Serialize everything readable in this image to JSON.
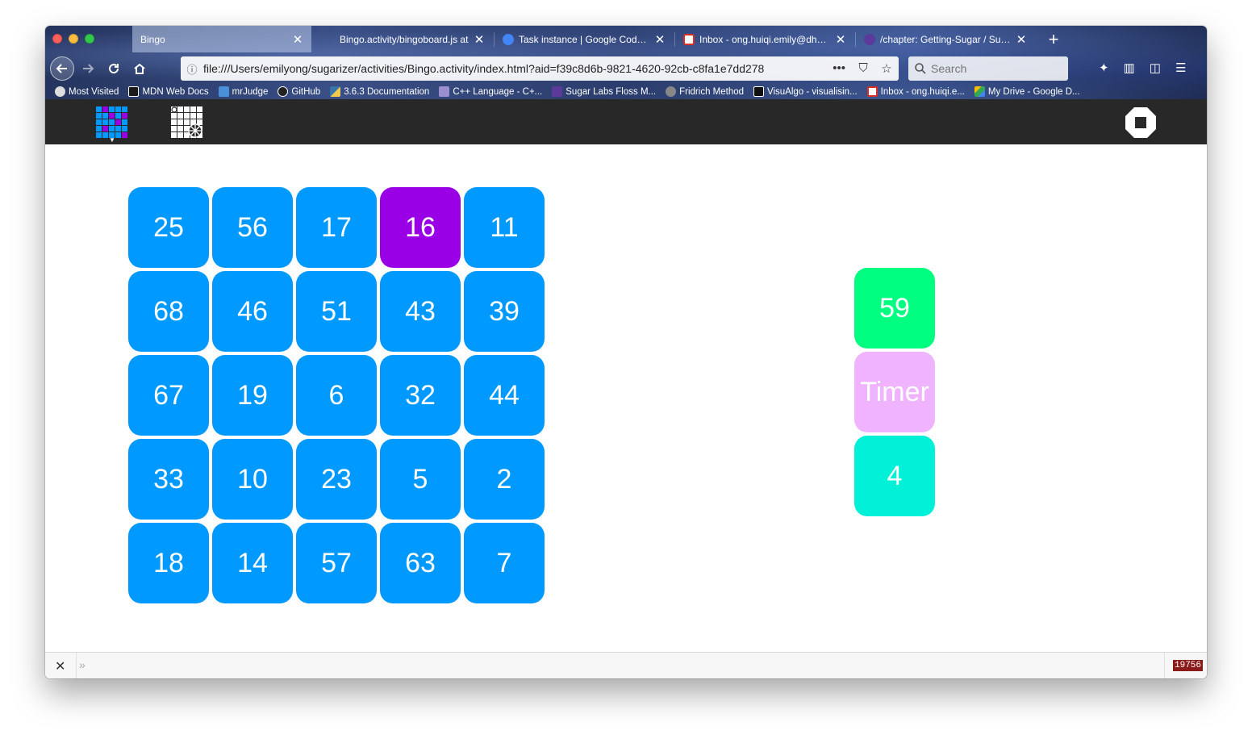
{
  "browser": {
    "tabs": [
      {
        "title": "Bingo",
        "active": true
      },
      {
        "title": "Bingo.activity/bingoboard.js at",
        "active": false
      },
      {
        "title": "Task instance | Google Code-in",
        "active": false
      },
      {
        "title": "Inbox - ong.huiqi.emily@dhs.sc",
        "active": false
      },
      {
        "title": "/chapter: Getting-Sugar / Sugar",
        "active": false
      }
    ],
    "close_glyph": "✕",
    "new_tab_glyph": "+",
    "url": "file:///Users/emilyong/sugarizer/activities/Bingo.activity/index.html?aid=f39c8d6b-9821-4620-92cb-c8fa1e7dd278",
    "search_placeholder": "Search",
    "bookmarks": [
      {
        "label": "Most Visited",
        "icon": "gear-icon",
        "color": "#dddddd"
      },
      {
        "label": "MDN Web Docs",
        "icon": "mdn-icon",
        "color": "#1a1a1a"
      },
      {
        "label": "mrJudge",
        "icon": "mrjudge-icon",
        "color": "#4a90d9"
      },
      {
        "label": "GitHub",
        "icon": "github-icon",
        "color": "#222222"
      },
      {
        "label": "3.6.3 Documentation",
        "icon": "python-icon",
        "color": "#f2c94c"
      },
      {
        "label": "C++ Language - C+...",
        "icon": "cpp-icon",
        "color": "#9b8fd0"
      },
      {
        "label": "Sugar Labs Floss M...",
        "icon": "sugar-icon",
        "color": "#5b3a9c"
      },
      {
        "label": "Fridrich Method",
        "icon": "globe-icon",
        "color": "#888888"
      },
      {
        "label": "VisuAlgo - visualisin...",
        "icon": "visualgo-icon",
        "color": "#111111"
      },
      {
        "label": "Inbox - ong.huiqi.e...",
        "icon": "gmail-icon",
        "color": "#d93025"
      },
      {
        "label": "My Drive - Google D...",
        "icon": "drive-icon",
        "color": "#34a853"
      }
    ]
  },
  "board": {
    "cells": [
      {
        "value": "25",
        "color": "#0099ff"
      },
      {
        "value": "56",
        "color": "#0099ff"
      },
      {
        "value": "17",
        "color": "#0099ff"
      },
      {
        "value": "16",
        "color": "#9900e6"
      },
      {
        "value": "11",
        "color": "#0099ff"
      },
      {
        "value": "68",
        "color": "#0099ff"
      },
      {
        "value": "46",
        "color": "#0099ff"
      },
      {
        "value": "51",
        "color": "#0099ff"
      },
      {
        "value": "43",
        "color": "#0099ff"
      },
      {
        "value": "39",
        "color": "#0099ff"
      },
      {
        "value": "67",
        "color": "#0099ff"
      },
      {
        "value": "19",
        "color": "#0099ff"
      },
      {
        "value": "6",
        "color": "#0099ff"
      },
      {
        "value": "32",
        "color": "#0099ff"
      },
      {
        "value": "44",
        "color": "#0099ff"
      },
      {
        "value": "33",
        "color": "#0099ff"
      },
      {
        "value": "10",
        "color": "#0099ff"
      },
      {
        "value": "23",
        "color": "#0099ff"
      },
      {
        "value": "5",
        "color": "#0099ff"
      },
      {
        "value": "2",
        "color": "#0099ff"
      },
      {
        "value": "18",
        "color": "#0099ff"
      },
      {
        "value": "14",
        "color": "#0099ff"
      },
      {
        "value": "57",
        "color": "#0099ff"
      },
      {
        "value": "63",
        "color": "#0099ff"
      },
      {
        "value": "7",
        "color": "#0099ff"
      }
    ]
  },
  "side": {
    "current_number": {
      "label": "59",
      "color": "#00ff80"
    },
    "timer": {
      "label": "Timer",
      "color": "#f0b3ff"
    },
    "count": {
      "label": "4",
      "color": "#00f0d8"
    }
  },
  "findbar": {
    "close_glyph": "✕",
    "more_glyph": "»",
    "counter": "19756"
  },
  "colors": {
    "sugar_toolbar": "#282828",
    "cell_default": "#0099ff",
    "cell_marked": "#9900e6"
  }
}
